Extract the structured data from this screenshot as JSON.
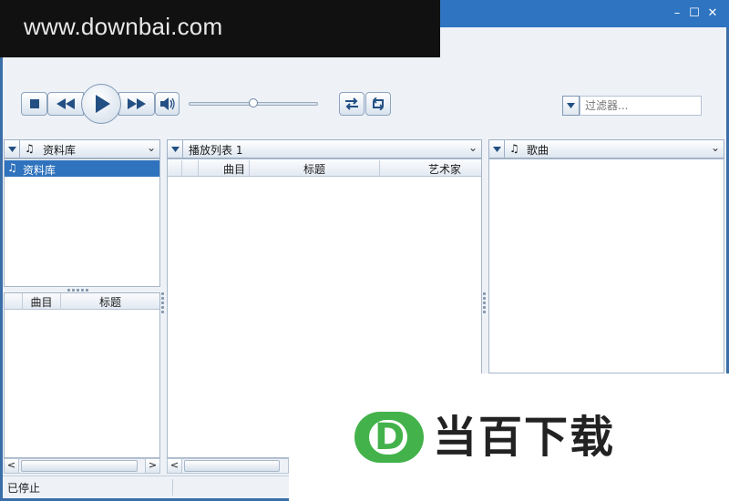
{
  "watermark": {
    "text": "www.downbai.com"
  },
  "window_controls": {
    "minimize": "–",
    "maximize": "☐",
    "close": "✕"
  },
  "transport": {
    "stop_icon": "stop-icon",
    "prev_icon": "rewind-icon",
    "play_icon": "play-icon",
    "next_icon": "fast-forward-icon",
    "volume_icon": "volume-icon",
    "volume_level": 0.5,
    "shuffle_icon": "shuffle-icon",
    "repeat_icon": "repeat-icon"
  },
  "filter": {
    "placeholder": "过滤器..."
  },
  "library_pane": {
    "source_label": "资料库",
    "items": [
      {
        "label": "资料库"
      }
    ],
    "columns": [
      "曲目",
      "标题"
    ]
  },
  "playlist_pane": {
    "source_label": "播放列表 1",
    "columns": [
      "曲目",
      "标题",
      "艺术家"
    ]
  },
  "songs_pane": {
    "source_label": "歌曲"
  },
  "status": {
    "text": "已停止"
  },
  "promo": {
    "logo_letter": "D",
    "text": "当百下载"
  },
  "colors": {
    "accent": "#2f72bd",
    "titlebar": "#2f74c0",
    "promo_green": "#43b24a"
  }
}
